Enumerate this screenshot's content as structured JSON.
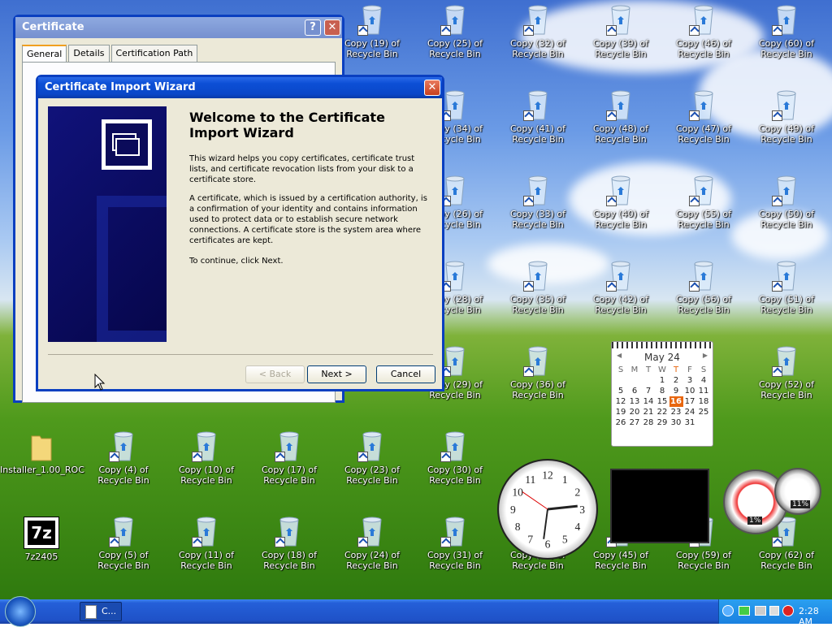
{
  "desktop_icons": [
    {
      "label": "Copy (19) of Recycle Bin"
    },
    {
      "label": "Copy (25) of Recycle Bin"
    },
    {
      "label": "Copy (32) of Recycle Bin"
    },
    {
      "label": "Copy (39) of Recycle Bin"
    },
    {
      "label": "Copy (46) of Recycle Bin"
    },
    {
      "label": "Copy (60) of Recycle Bin"
    },
    {
      "label": "Copy (34) of Recycle Bin"
    },
    {
      "label": "Copy (41) of Recycle Bin"
    },
    {
      "label": "Copy (48) of Recycle Bin"
    },
    {
      "label": "Copy (47) of Recycle Bin"
    },
    {
      "label": "Copy (49) of Recycle Bin"
    },
    {
      "label": "Copy (26) of Recycle Bin"
    },
    {
      "label": "Copy (33) of Recycle Bin"
    },
    {
      "label": "Copy (40) of Recycle Bin"
    },
    {
      "label": "Copy (55) of Recycle Bin"
    },
    {
      "label": "Copy (50) of Recycle Bin"
    },
    {
      "label": "Copy (28) of Recycle Bin"
    },
    {
      "label": "Copy (35) of Recycle Bin"
    },
    {
      "label": "Copy (42) of Recycle Bin"
    },
    {
      "label": "Copy (56) of Recycle Bin"
    },
    {
      "label": "Copy (51) of Recycle Bin"
    },
    {
      "label": "Copy (29) of Recycle Bin"
    },
    {
      "label": "Copy (36) of Recycle Bin"
    },
    {
      "label": "Copy (52) of Recycle Bin"
    },
    {
      "label": "Copy (4) of Recycle Bin"
    },
    {
      "label": "Copy (10) of Recycle Bin"
    },
    {
      "label": "Copy (17) of Recycle Bin"
    },
    {
      "label": "Copy (23) of Recycle Bin"
    },
    {
      "label": "Copy (30) of Recycle Bin"
    },
    {
      "label": "Copy (5) of Recycle Bin"
    },
    {
      "label": "Copy (11) of Recycle Bin"
    },
    {
      "label": "Copy (18) of Recycle Bin"
    },
    {
      "label": "Copy (24) of Recycle Bin"
    },
    {
      "label": "Copy (31) of Recycle Bin"
    },
    {
      "label": "Copy (38) of Recycle Bin"
    },
    {
      "label": "Copy (45) of Recycle Bin"
    },
    {
      "label": "Copy (59) of Recycle Bin"
    },
    {
      "label": "Copy (62) of Recycle Bin"
    }
  ],
  "installer": {
    "label": "Installer_1.00_ROC"
  },
  "sevenzip": {
    "label": "7z2405",
    "icon_text": "7z"
  },
  "certificate": {
    "title": "Certificate",
    "help": "?",
    "close": "✕",
    "tabs": [
      "General",
      "Details",
      "Certification Path"
    ]
  },
  "wizard": {
    "title": "Certificate Import Wizard",
    "close": "✕",
    "heading": "Welcome to the Certificate Import Wizard",
    "p1": "This wizard helps you copy certificates, certificate trust lists, and certificate revocation lists from your disk to a certificate store.",
    "p2": "A certificate, which is issued by a certification authority, is a confirmation of your identity and contains information used to protect data or to establish secure network connections. A certificate store is the system area where certificates are kept.",
    "p3": "To continue, click Next.",
    "back": "< Back",
    "next": "Next >",
    "cancel": "Cancel"
  },
  "calendar": {
    "month": "May 24",
    "prev": "◀",
    "next": "▶",
    "days": [
      "S",
      "M",
      "T",
      "W",
      "T",
      "F",
      "S"
    ],
    "weeks": [
      [
        "",
        "",
        "",
        "1",
        "2",
        "3",
        "4"
      ],
      [
        "5",
        "6",
        "7",
        "8",
        "9",
        "10",
        "11"
      ],
      [
        "12",
        "13",
        "14",
        "15",
        "16",
        "17",
        "18"
      ],
      [
        "19",
        "20",
        "21",
        "22",
        "23",
        "24",
        "25"
      ],
      [
        "26",
        "27",
        "28",
        "29",
        "30",
        "31",
        ""
      ]
    ],
    "today": "16"
  },
  "gauge": {
    "cpu": "1%",
    "mem": "11%"
  },
  "clock_numbers": [
    "12",
    "1",
    "2",
    "3",
    "4",
    "5",
    "6",
    "7",
    "8",
    "9",
    "10",
    "11"
  ],
  "taskbar": {
    "task_label": "C...",
    "time": "2:28 AM"
  },
  "colors": {
    "title_blue": "#0a47c8",
    "taskbar_blue": "#245fd8",
    "today": "#e8660e"
  }
}
